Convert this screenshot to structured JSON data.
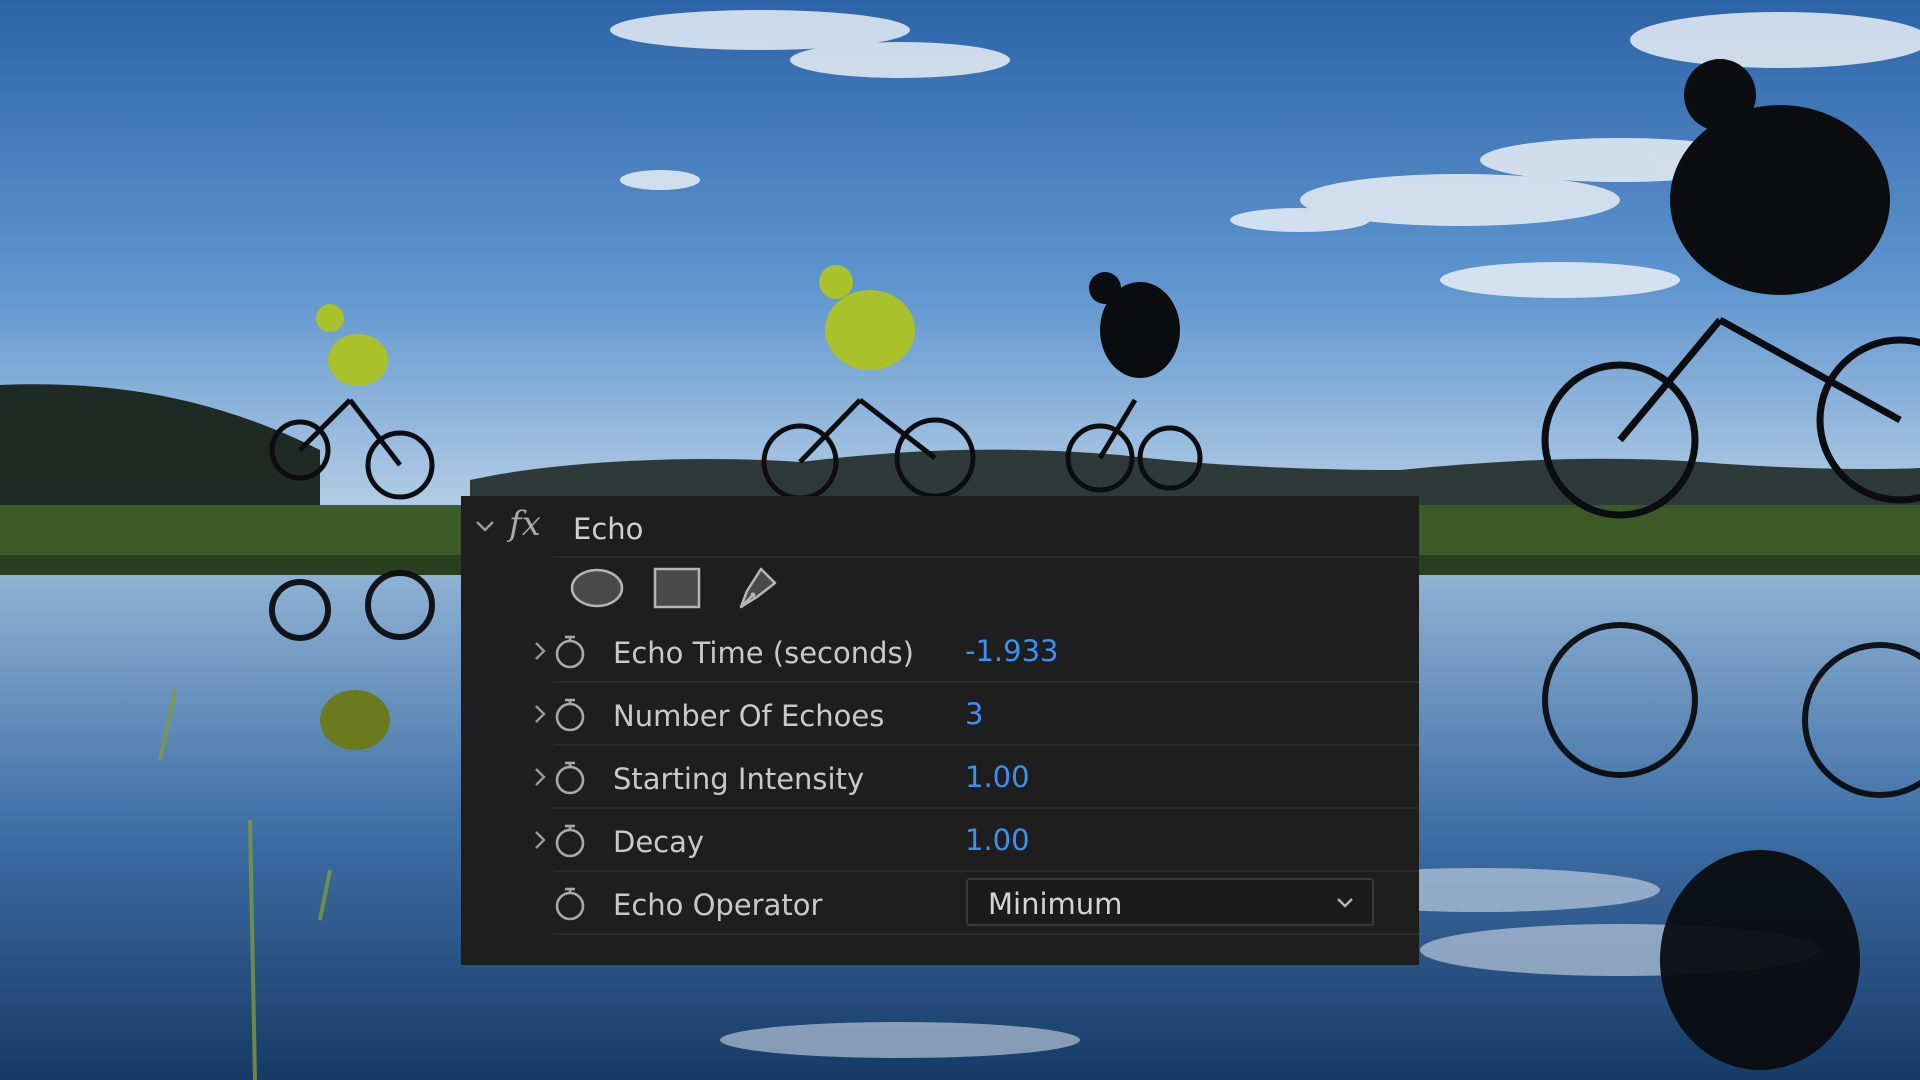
{
  "effect": {
    "name": "Echo",
    "fx_glyph": "fx",
    "collapse_icon": "chevron-down-icon",
    "mask_tools": [
      "ellipse-mask-icon",
      "rectangle-mask-icon",
      "pen-mask-icon"
    ]
  },
  "params": [
    {
      "label": "Echo Time (seconds)",
      "value": "-1.933",
      "has_twirl": true
    },
    {
      "label": "Number Of Echoes",
      "value": "3",
      "has_twirl": true
    },
    {
      "label": "Starting Intensity",
      "value": "1.00",
      "has_twirl": true
    },
    {
      "label": "Decay",
      "value": "1.00",
      "has_twirl": true
    }
  ],
  "operator": {
    "label": "Echo Operator",
    "selected": "Minimum"
  },
  "colors": {
    "panel_bg": "#1e1e1e",
    "value_blue": "#3d8ff2",
    "label_text": "#c9c9c9"
  }
}
